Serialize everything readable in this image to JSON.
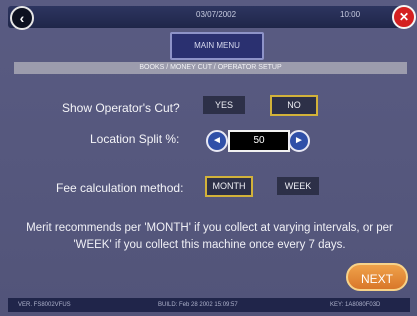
{
  "header": {
    "date": "03/07/2002",
    "time": "10:00"
  },
  "main_menu_label": "MAIN MENU",
  "breadcrumb": "BOOKS / MONEY CUT / OPERATOR SETUP",
  "operator_cut": {
    "label": "Show Operator's Cut?",
    "yes": "YES",
    "no": "NO",
    "selected": "NO"
  },
  "location_split": {
    "label": "Location Split %:",
    "value": "50"
  },
  "fee_method": {
    "label": "Fee calculation method:",
    "month": "MONTH",
    "week": "WEEK",
    "selected": "MONTH"
  },
  "note": "Merit recommends per 'MONTH' if you collect at varying intervals, or per 'WEEK' if you collect this machine once every 7 days.",
  "next_label": "NEXT",
  "footer": {
    "version": "VER. FS8002VFUS",
    "build": "BUILD: Feb 28 2002 15:09:57",
    "key": "KEY: 1A8080F03D"
  }
}
